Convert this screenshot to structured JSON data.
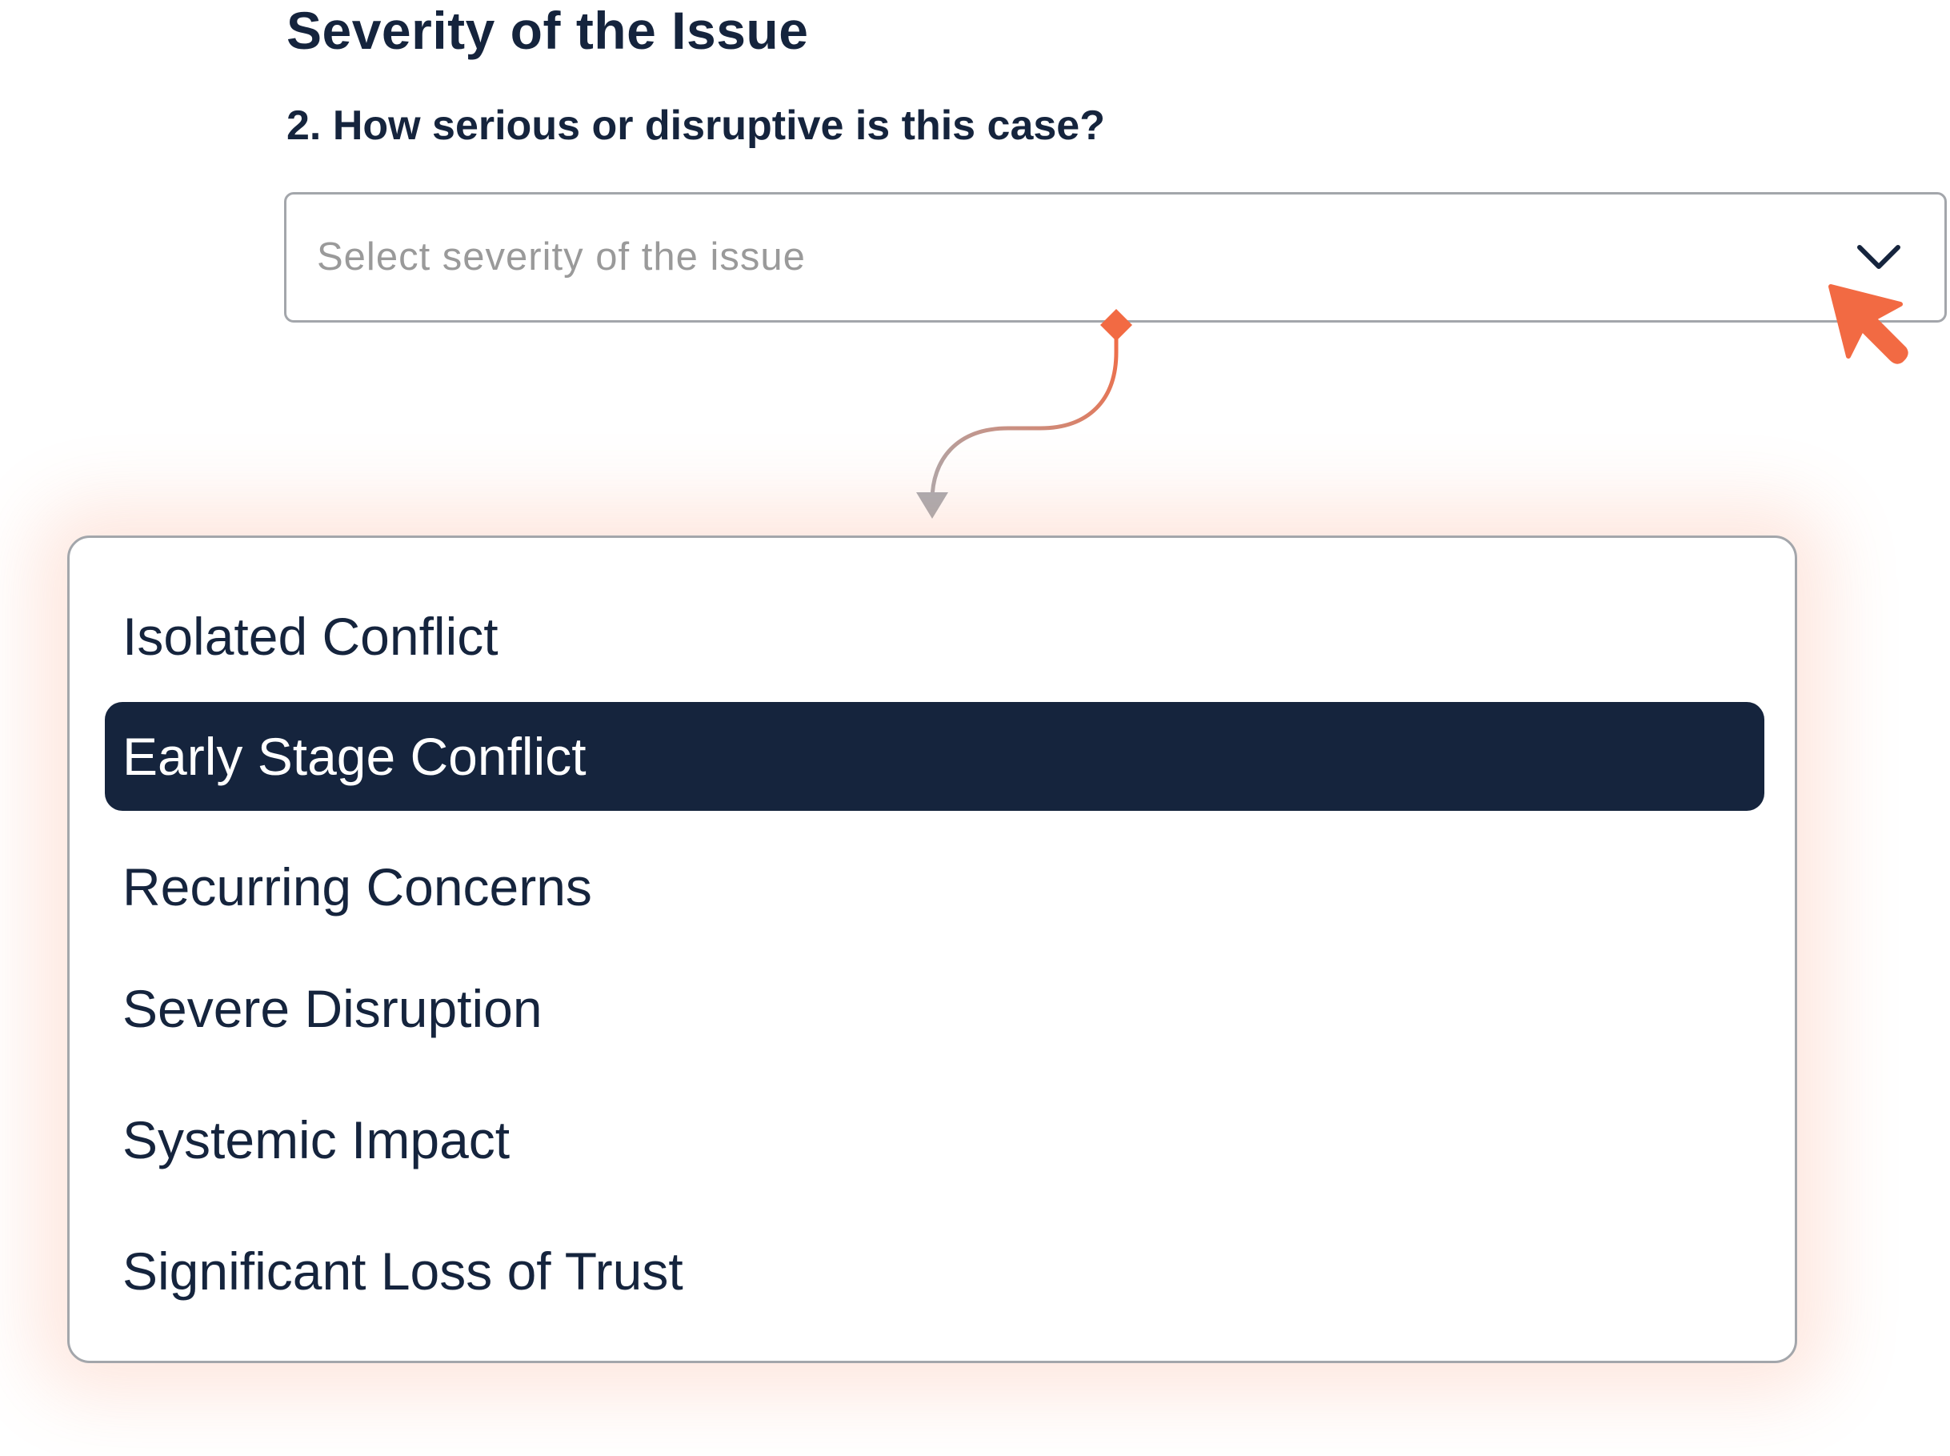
{
  "section": {
    "title": "Severity of the Issue"
  },
  "question": {
    "label": "2. How serious or disruptive is this case?"
  },
  "select": {
    "placeholder": "Select severity of the issue",
    "chevron_icon": "chevron-down-icon"
  },
  "dropdown": {
    "options": [
      {
        "label": "Isolated Conflict",
        "selected": false
      },
      {
        "label": "Early Stage Conflict",
        "selected": true
      },
      {
        "label": "Recurring Concerns",
        "selected": false
      },
      {
        "label": "Severe Disruption",
        "selected": false
      },
      {
        "label": "Systemic Impact",
        "selected": false
      },
      {
        "label": "Significant Loss of Trust",
        "selected": false
      }
    ]
  },
  "colors": {
    "text": "#15243d",
    "selected_bg": "#15243d",
    "accent": "#f26a43",
    "border": "#a3a6ab",
    "placeholder": "#9a9a9a"
  },
  "icons": {
    "cursor": "cursor-arrow-icon",
    "connector": "curved-arrow-connector"
  }
}
